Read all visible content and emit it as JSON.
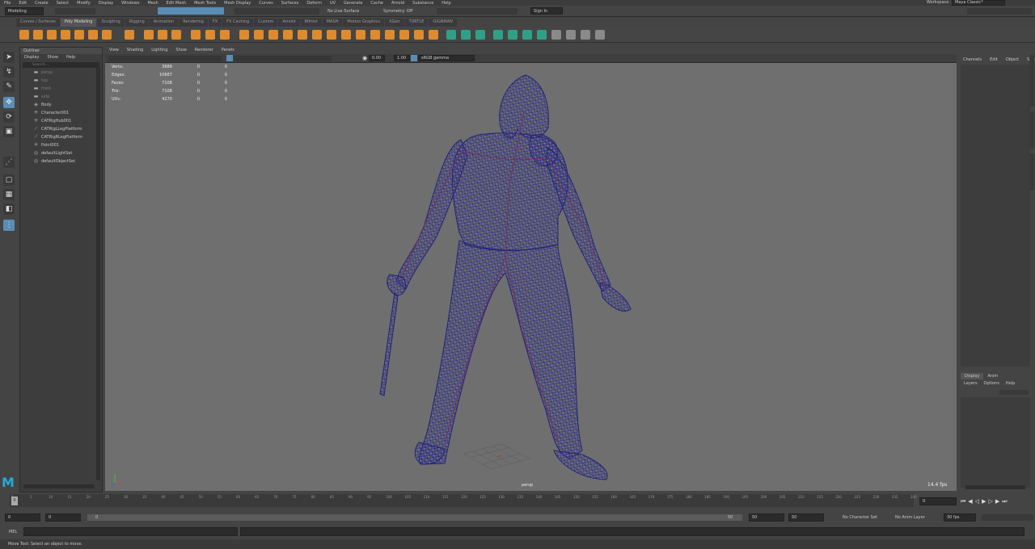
{
  "menubar": {
    "items": [
      "File",
      "Edit",
      "Create",
      "Select",
      "Modify",
      "Display",
      "Windows",
      "Mesh",
      "Edit Mesh",
      "Mesh Tools",
      "Mesh Display",
      "Curves",
      "Surfaces",
      "Deform",
      "UV",
      "Generate",
      "Cache",
      "Arnold",
      "Substance",
      "Help"
    ],
    "workspace_label": "Workspace :",
    "workspace_value": "Maya Classic*"
  },
  "statusline": {
    "mode": "Modeling",
    "live_surface": "No Live Surface",
    "symmetry": "Symmetry: Off",
    "sign_in": "Sign In"
  },
  "shelf": {
    "tabs": [
      "Curves / Surfaces",
      "Poly Modeling",
      "Sculpting",
      "Rigging",
      "Animation",
      "Rendering",
      "FX",
      "FX Caching",
      "Custom",
      "Arnold",
      "Bifrost",
      "MASH",
      "Motion Graphics",
      "XGen",
      "TURTLE",
      "OIGNMAN"
    ],
    "active_tab": "Poly Modeling",
    "accent": "#e08a2e",
    "accent2": "#2fa088"
  },
  "outliner": {
    "title": "Outliner",
    "menu": [
      "Display",
      "Show",
      "Help"
    ],
    "search_placeholder": "Search...",
    "items": [
      {
        "label": "persp",
        "icon": "camera-icon",
        "dim": true
      },
      {
        "label": "top",
        "icon": "camera-icon",
        "dim": true
      },
      {
        "label": "front",
        "icon": "camera-icon",
        "dim": true
      },
      {
        "label": "side",
        "icon": "camera-icon",
        "dim": true
      },
      {
        "label": "Body",
        "icon": "mesh-icon",
        "dim": false
      },
      {
        "label": "Character001",
        "icon": "joint-icon",
        "dim": false
      },
      {
        "label": "CATRigHub001",
        "icon": "joint-icon",
        "dim": false
      },
      {
        "label": "CATRigLLegPlatform",
        "icon": "curve-icon",
        "dim": false
      },
      {
        "label": "CATRigRLegPlatform",
        "icon": "curve-icon",
        "dim": false
      },
      {
        "label": "Point001",
        "icon": "joint-icon",
        "dim": false
      },
      {
        "label": "defaultLightSet",
        "icon": "set-icon",
        "dim": false
      },
      {
        "label": "defaultObjectSet",
        "icon": "set-icon",
        "dim": false
      }
    ]
  },
  "viewport": {
    "menu": [
      "View",
      "Shading",
      "Lighting",
      "Show",
      "Renderer",
      "Panels"
    ],
    "near_value": "0.00",
    "far_value": "1.00",
    "color_space": "sRGB gamma",
    "camera_label": "persp",
    "fps": "14.4 fps",
    "hud": [
      {
        "label": "Verts:",
        "value": "3689",
        "a": "0",
        "b": "0"
      },
      {
        "label": "Edges:",
        "value": "10687",
        "a": "0",
        "b": "0"
      },
      {
        "label": "Faces:",
        "value": "7108",
        "a": "0",
        "b": "0"
      },
      {
        "label": "Tris:",
        "value": "7108",
        "a": "0",
        "b": "0"
      },
      {
        "label": "UVs:",
        "value": "4270",
        "a": "0",
        "b": "0"
      }
    ],
    "wire_color": "#2a2a8c"
  },
  "channelbox": {
    "tabs": [
      "Channels",
      "Edit",
      "Object",
      "Show"
    ],
    "layer_tabs": [
      "Display",
      "Anim"
    ],
    "layer_menu": [
      "Layers",
      "Options",
      "Help"
    ],
    "side_tabs": [
      "Channel Box / Layer Editor",
      "Modeling Toolkit",
      "Attribute Editor"
    ]
  },
  "timeline": {
    "ticks": [
      "0",
      "5",
      "10",
      "15",
      "20",
      "25",
      "30",
      "35",
      "40",
      "45",
      "50",
      "55",
      "60",
      "65",
      "70",
      "75",
      "80",
      "85",
      "90",
      "95",
      "100",
      "105",
      "110",
      "115",
      "120",
      "125",
      "130",
      "135",
      "140",
      "145",
      "150",
      "155",
      "160",
      "165",
      "170",
      "175",
      "180",
      "185",
      "190",
      "195",
      "200",
      "205",
      "210",
      "215",
      "220",
      "225",
      "230",
      "235",
      "240"
    ],
    "current_frame": "0",
    "current_frame_field": "0"
  },
  "range": {
    "start": "0",
    "start2": "0",
    "range_start": "0",
    "range_end": "50",
    "end": "50",
    "end2": "50",
    "character_set": "No Character Set",
    "anim_layer": "No Anim Layer",
    "fps": "30 fps"
  },
  "cmdline": {
    "label": "MEL"
  },
  "helpline": {
    "text": "Move Tool: Select an object to move."
  }
}
